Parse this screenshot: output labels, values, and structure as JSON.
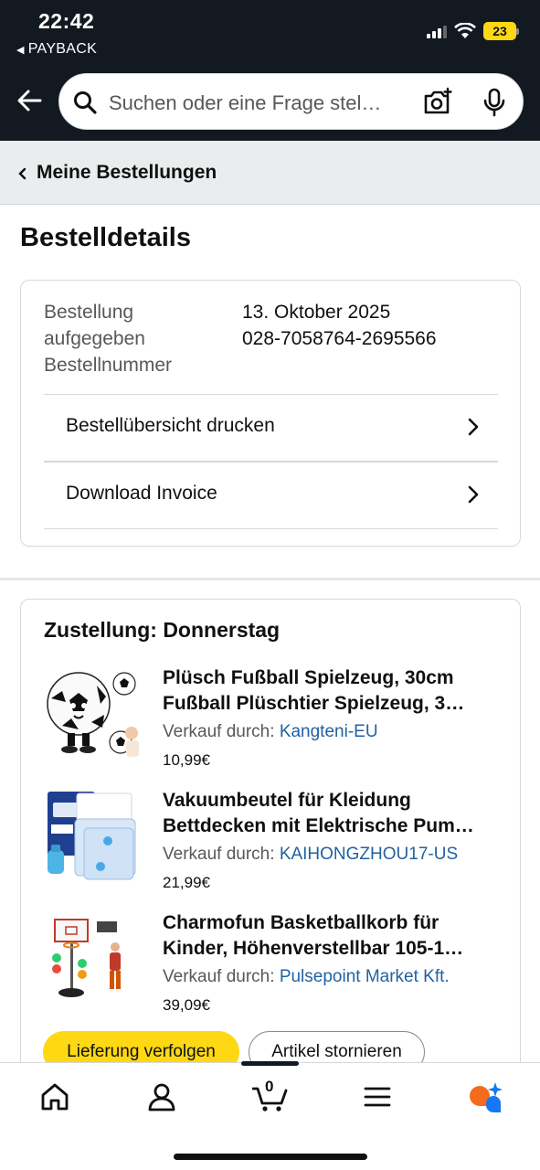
{
  "status_bar": {
    "time": "22:42",
    "back_app": "PAYBACK",
    "battery": "23"
  },
  "search": {
    "placeholder": "Suchen oder eine Frage stel…"
  },
  "breadcrumb": {
    "label": "Meine Bestellungen"
  },
  "page": {
    "title": "Bestelldetails"
  },
  "order_info": {
    "placed_label_line1": "Bestellung",
    "placed_label_line2": "aufgegeben",
    "number_label": "Bestellnummer",
    "placed_value": "13. Oktober 2025",
    "number_value": "028-7058764-2695566"
  },
  "actions": {
    "print_summary": "Bestellübersicht drucken",
    "download_invoice": "Download Invoice"
  },
  "delivery": {
    "title": "Zustellung: Donnerstag",
    "seller_prefix": "Verkauf durch:",
    "items": [
      {
        "title_line1": "Plüsch Fußball Spielzeug, 30cm",
        "title_line2": "Fußball Plüschtier Spielzeug, 3…",
        "seller": "Kangteni-EU",
        "price": "10,99€"
      },
      {
        "title_line1": "Vakuumbeutel für Kleidung",
        "title_line2": "Bettdecken mit Elektrische Pum…",
        "seller": "KAIHONGZHOU17-US",
        "price": "21,99€"
      },
      {
        "title_line1": "Charmofun Basketballkorb für",
        "title_line2": "Kinder, Höhenverstellbar 105-1…",
        "seller": "Pulsepoint Market Kft.",
        "price": "39,09€"
      }
    ],
    "track_button": "Lieferung verfolgen",
    "cancel_button": "Artikel stornieren"
  },
  "bottom_nav": {
    "cart_count": "0"
  },
  "colors": {
    "header_bg": "#131921",
    "link": "#2162a1",
    "primary_button": "#ffd814",
    "battery": "#ffd814"
  }
}
